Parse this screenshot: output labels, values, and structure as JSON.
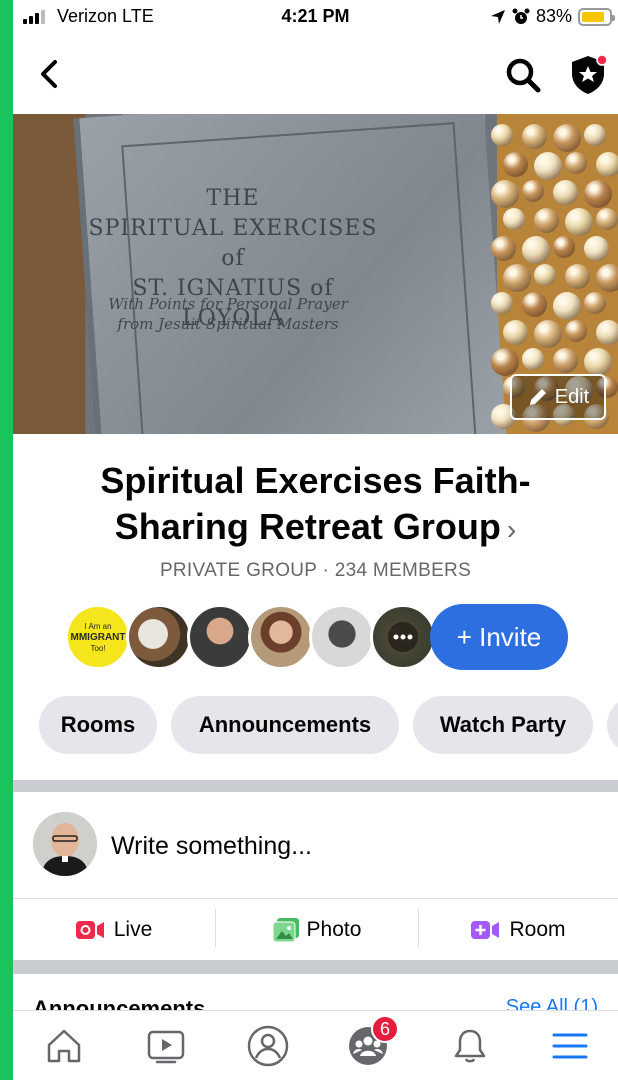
{
  "status_bar": {
    "carrier": "Verizon  LTE",
    "time": "4:21 PM",
    "battery": "83%",
    "battery_level": 0.83
  },
  "cover": {
    "book_title_lines": [
      "THE",
      "SPIRITUAL EXERCISES of",
      "ST. IGNATIUS of LOYOLA"
    ],
    "book_subtitle_lines": [
      "With Points for Personal Prayer",
      "from Jesuit Spiritual Masters"
    ],
    "edit_label": "Edit"
  },
  "group": {
    "title_line1": "Spiritual Exercises Faith-",
    "title_line2": "Sharing Retreat Group",
    "meta": "PRIVATE GROUP · 234 MEMBERS",
    "first_member_badge": [
      "I Am an",
      "MMIGRANT",
      "Too!"
    ],
    "invite_label": "+ Invite"
  },
  "chips": [
    "Rooms",
    "Announcements",
    "Watch Party"
  ],
  "composer": {
    "placeholder": "Write something..."
  },
  "actions": {
    "live": "Live",
    "photo": "Photo",
    "room": "Room"
  },
  "peek": {
    "section": "Announcements",
    "see_all": "See All (1)"
  },
  "tabs": {
    "groups_badge": "6"
  },
  "colors": {
    "accent": "#2d6fe0",
    "chip_bg": "#e4e6eb",
    "badge": "#e41e3f",
    "side_bar": "#19c45c",
    "live": "#f02849",
    "photo": "#45bd62",
    "room": "#a259ff"
  }
}
